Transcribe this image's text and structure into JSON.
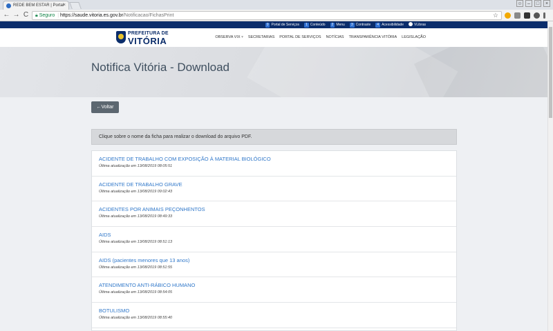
{
  "browser": {
    "tab_title": "REDE BEM ESTAR | Portal",
    "tab_close": "×",
    "url_secure_label": "Seguro",
    "url_scheme_host": "https://saude.vitoria.es.gov.br",
    "url_path": "/Notificacao/FichasPrint",
    "back": "←",
    "forward": "→",
    "reload": "C",
    "star": "☆"
  },
  "accessibility_bar": {
    "items": [
      {
        "key": "0",
        "label": "Portal de Serviços"
      },
      {
        "key": "1",
        "label": "Conteúdo"
      },
      {
        "key": "2",
        "label": "Menu"
      },
      {
        "key": "3",
        "label": "Contraste"
      },
      {
        "key": "4",
        "label": "Acessibilidade"
      }
    ],
    "vlibras": "VLibras"
  },
  "logo": {
    "line1": "PREFEITURA DE",
    "line2": "VITÓRIA"
  },
  "nav": [
    {
      "label": "OBSERVA VIX",
      "caret": "▾"
    },
    {
      "label": "SECRETARIAS"
    },
    {
      "label": "PORTAL DE SERVIÇOS"
    },
    {
      "label": "NOTÍCIAS"
    },
    {
      "label": "TRANSPARÊNCIA VITÓRIA"
    },
    {
      "label": "LEGISLAÇÃO"
    }
  ],
  "page": {
    "title": "Notifica Vitória - Download",
    "back_button": "Voltar",
    "back_arrow": "←",
    "notice": "Clique sobre o nome da ficha para realizar o download do arquivo PDF."
  },
  "fichas": [
    {
      "title": "ACIDENTE DE TRABALHO COM EXPOSIÇÃO À MATERIAL BIOLÓGICO",
      "updated": "Última atualização em 13/08/2019 08:05:51"
    },
    {
      "title": "ACIDENTE DE TRABALHO GRAVE",
      "updated": "Última atualização em 13/08/2019 09:02:43"
    },
    {
      "title": "ACIDENTES POR ANIMAIS PEÇONHENTOS",
      "updated": "Última atualização em 13/08/2019 08:49:33"
    },
    {
      "title": "AIDS",
      "updated": "Última atualização em 13/08/2019 08:51:13"
    },
    {
      "title": "AIDS (pacientes menores que 13 anos)",
      "updated": "Última atualização em 13/08/2019 08:51:55"
    },
    {
      "title": "ATENDIMENTO ANTI-RÁBICO HUMANO",
      "updated": "Última atualização em 13/08/2019 08:54:05"
    },
    {
      "title": "BOTULISMO",
      "updated": "Última atualização em 13/08/2019 08:55:40"
    }
  ],
  "colors": {
    "topbar": "#0b2d6b",
    "link": "#2f77c9",
    "back_button": "#5c6770"
  }
}
